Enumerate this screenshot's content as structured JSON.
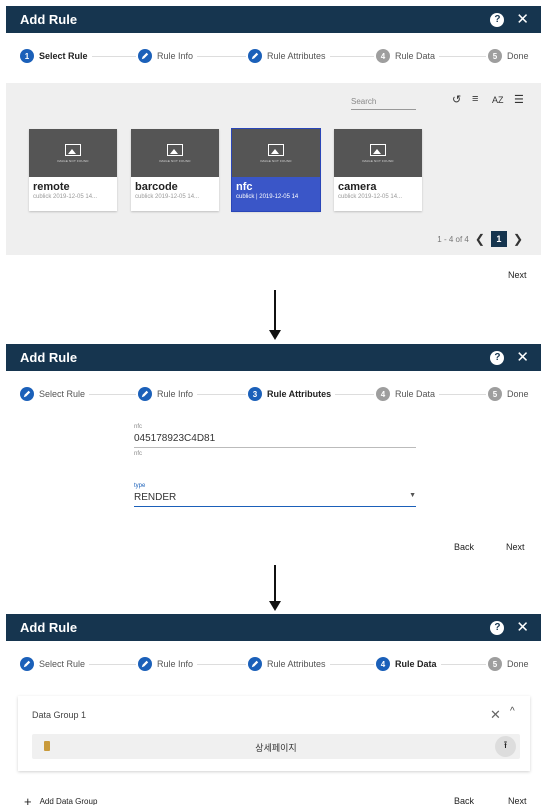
{
  "dialog_title": "Add Rule",
  "help_glyph": "?",
  "close_glyph": "✕",
  "steps": [
    {
      "num": "1",
      "label": "Select Rule"
    },
    {
      "num": "2",
      "label": "Rule Info"
    },
    {
      "num": "3",
      "label": "Rule Attributes"
    },
    {
      "num": "4",
      "label": "Rule Data"
    },
    {
      "num": "5",
      "label": "Done"
    }
  ],
  "panel1": {
    "search_placeholder": "Search",
    "toolbar_icons": [
      "refresh-icon",
      "sort-icon",
      "sort-az-icon",
      "list-view-icon"
    ],
    "toolbar_glyphs": {
      "refresh": "↺",
      "sort": "≡",
      "az": "AZ",
      "list": "☰"
    },
    "image_not_found": "IMAGE NOT FOUND",
    "cards": [
      {
        "name": "remote",
        "meta": "cublick   2019-12-05 14..."
      },
      {
        "name": "barcode",
        "meta": "cublick   2019-12-05 14..."
      },
      {
        "name": "nfc",
        "meta": "cublick | 2019-12-05 14"
      },
      {
        "name": "camera",
        "meta": "cublick   2019-12-05 14..."
      }
    ],
    "pagination": {
      "range": "1 - 4 of 4",
      "current_page": "1",
      "prev": "❮",
      "next": "❯"
    },
    "next_button": "Next"
  },
  "panel2": {
    "nfc_field": {
      "label": "nfc",
      "value": "045178923C4D81",
      "hint": "nfc"
    },
    "type_field": {
      "label": "type",
      "value": "RENDER",
      "caret": "▼"
    },
    "back_button": "Back",
    "next_button": "Next"
  },
  "panel3": {
    "group_title": "Data Group 1",
    "close_glyph": "✕",
    "collapse_glyph": "^",
    "row_label": "상세페이지",
    "upload_glyph": "⭱",
    "add_group_label": "Add Data Group",
    "add_glyph": "+",
    "back_button": "Back",
    "next_button": "Next"
  },
  "colors": {
    "header": "#16354f",
    "accent": "#1b60b9",
    "selected_card": "#3a56c8"
  }
}
